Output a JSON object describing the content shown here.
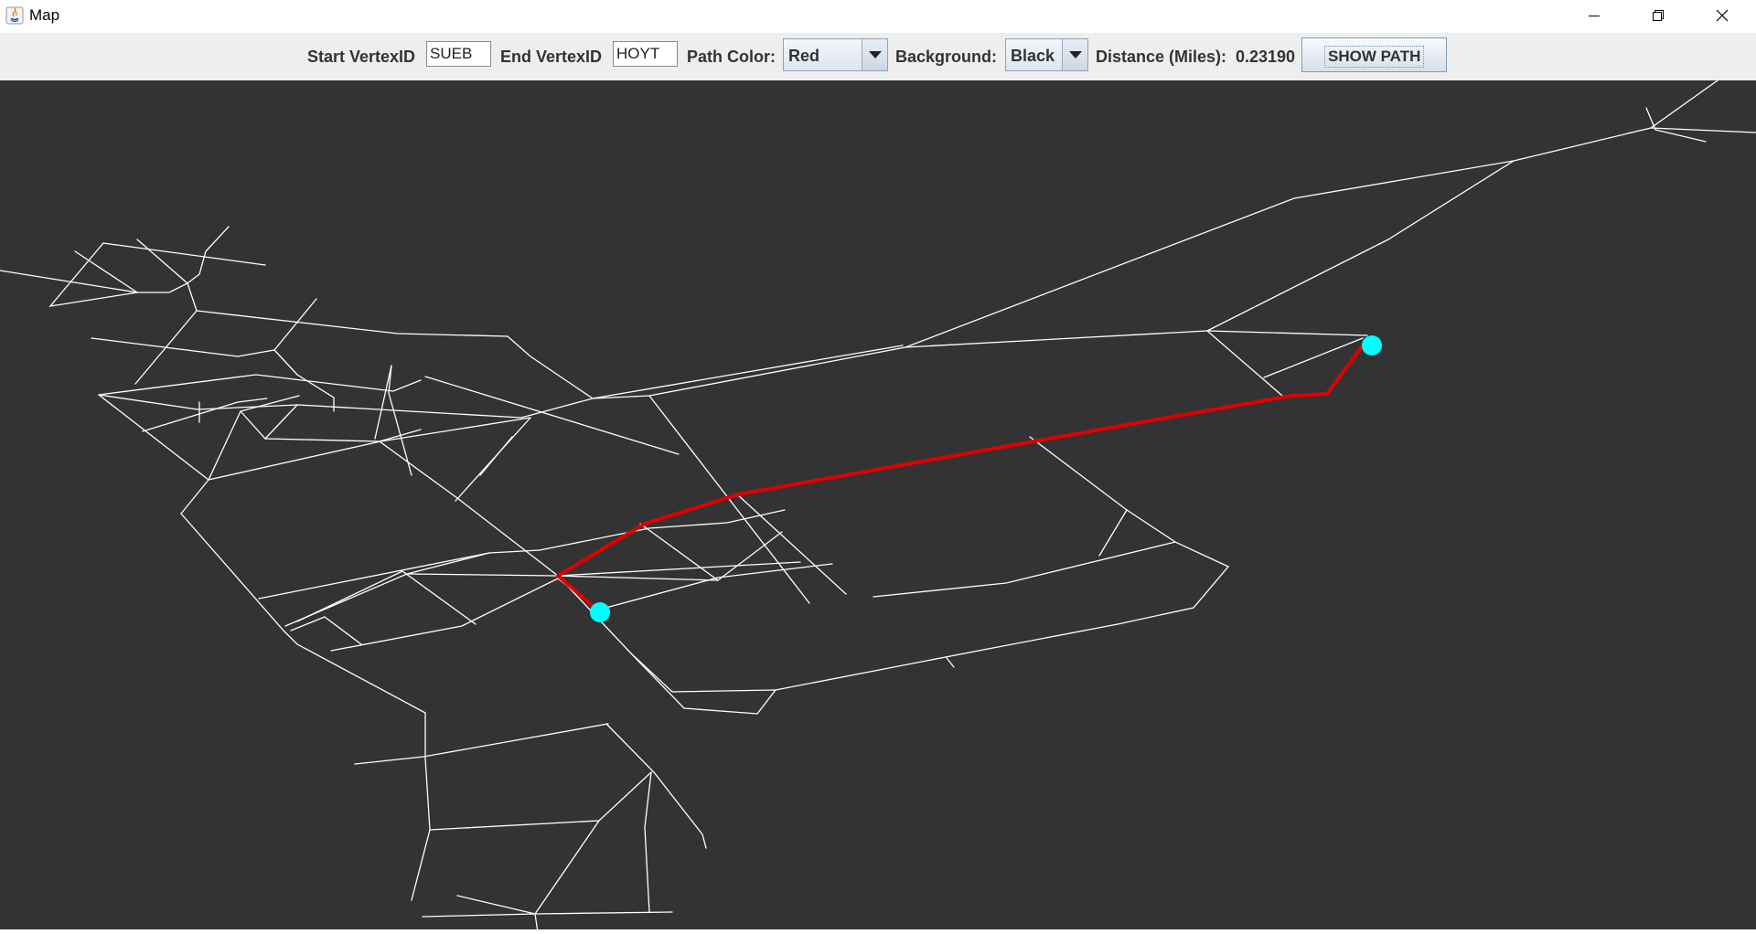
{
  "window": {
    "title": "Map",
    "controls": {
      "minimize_icon": "minimize-icon",
      "restore_icon": "restore-icon",
      "close_icon": "close-icon"
    }
  },
  "toolbar": {
    "start_label": "Start VertexID",
    "start_value": "SUEB",
    "end_label": "End VertexID",
    "end_value": "HOYT",
    "path_color_label": "Path Color:",
    "path_color_value": "Red",
    "background_label": "Background:",
    "background_value": "Black",
    "distance_label": "Distance (Miles):",
    "distance_value": "0.23190",
    "show_path_label": "SHOW PATH"
  },
  "map": {
    "background_color": "#333333",
    "edge_color": "#ffffff",
    "path_color": "#e00000",
    "marker_color": "#00ffff",
    "start_vertex": "SUEB",
    "end_vertex": "HOYT"
  }
}
